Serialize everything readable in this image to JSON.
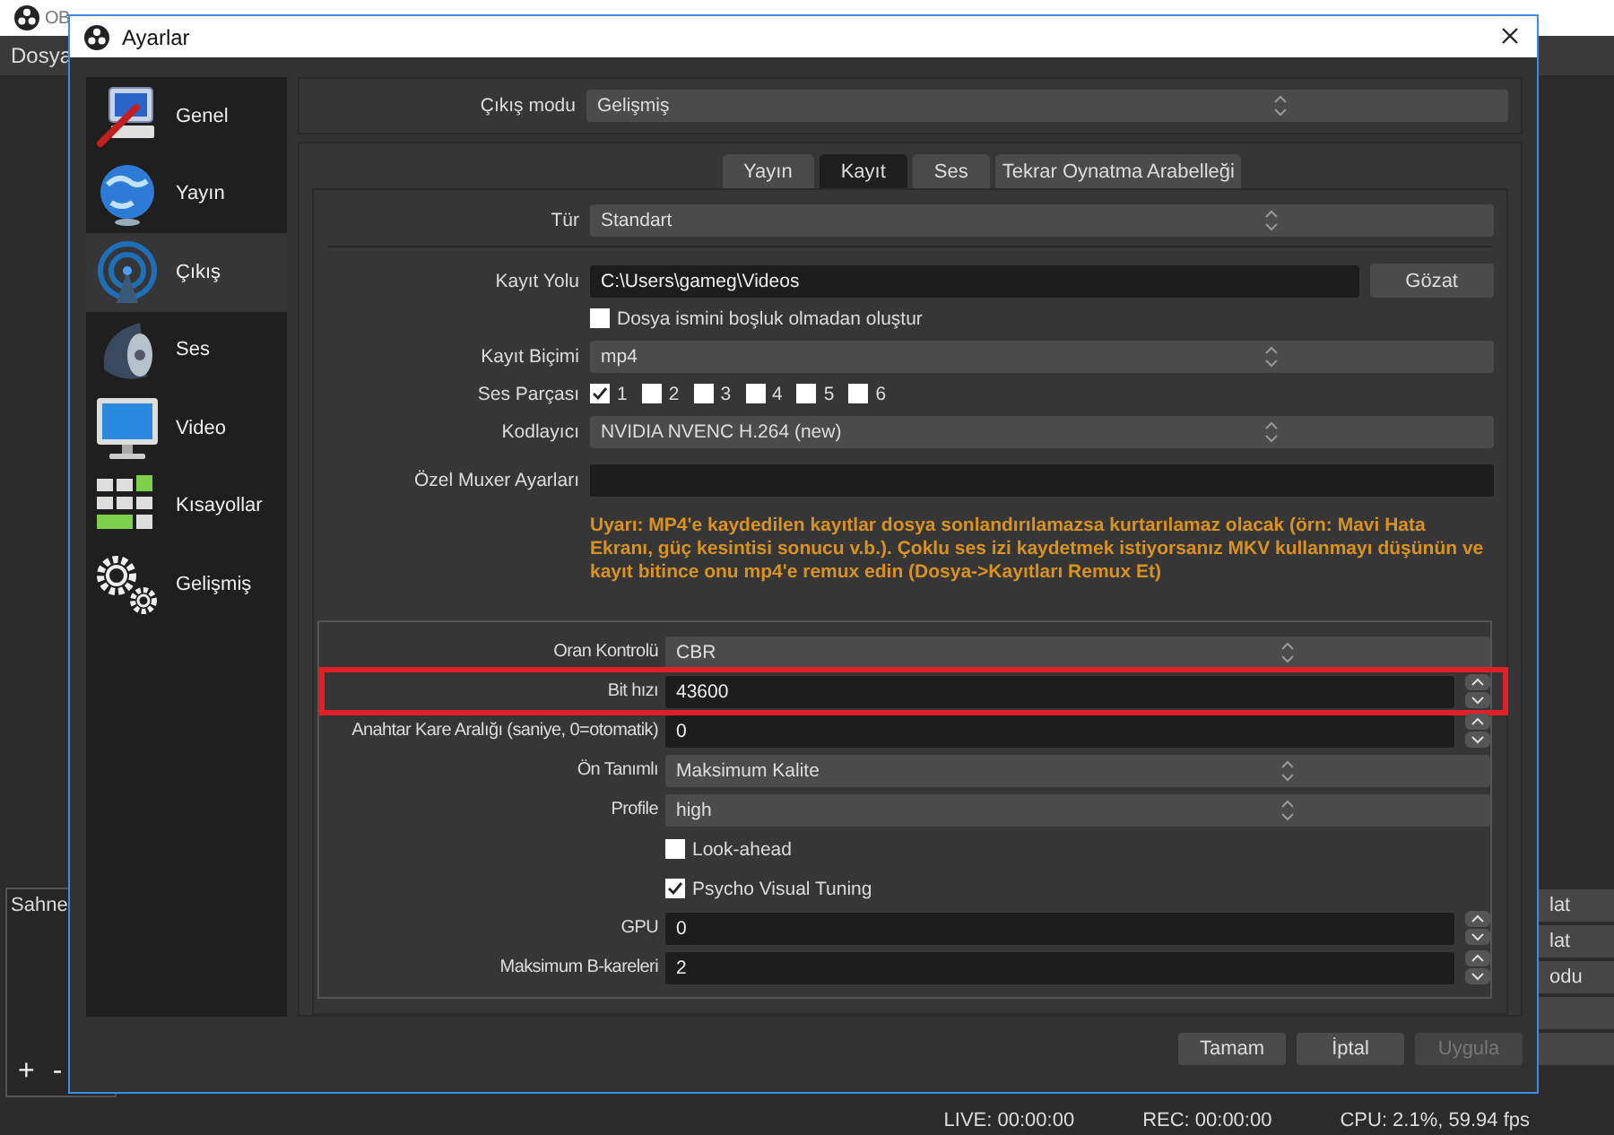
{
  "background_window": {
    "title": "OB",
    "menu": [
      "Dosya"
    ],
    "scenes_panel": {
      "title": "Sahne",
      "buttons": [
        "+",
        "-"
      ]
    },
    "side_buttons": [
      "lat",
      "lat",
      "odu"
    ],
    "status_bar": [
      "LIVE: 00:00:00",
      "REC: 00:00:00",
      "CPU: 2.1%, 59.94 fps"
    ]
  },
  "dialog": {
    "title": "Ayarlar",
    "sidebar": [
      {
        "label": "Genel",
        "selected": false
      },
      {
        "label": "Yayın",
        "selected": false
      },
      {
        "label": "Çıkış",
        "selected": true
      },
      {
        "label": "Ses",
        "selected": false
      },
      {
        "label": "Video",
        "selected": false
      },
      {
        "label": "Kısayollar",
        "selected": false
      },
      {
        "label": "Gelişmiş",
        "selected": false
      }
    ],
    "output_mode": {
      "label": "Çıkış modu",
      "value": "Gelişmiş"
    },
    "tabs": [
      {
        "label": "Yayın",
        "selected": false
      },
      {
        "label": "Kayıt",
        "selected": true
      },
      {
        "label": "Ses",
        "selected": false
      },
      {
        "label": "Tekrar Oynatma Arabelleği",
        "selected": false
      }
    ],
    "recording_type": {
      "label": "Tür",
      "value": "Standart"
    },
    "recording_rows": [
      {
        "kind": "path",
        "label": "Kayıt Yolu",
        "value": "C:\\Users\\gameg\\Videos",
        "button": "Gözat"
      },
      {
        "kind": "checkbox",
        "label": "Dosya ismini boşluk olmadan oluştur",
        "checked": false
      },
      {
        "kind": "select",
        "label": "Kayıt Biçimi",
        "value": "mp4"
      },
      {
        "kind": "tracks",
        "label": "Ses Parçası",
        "tracks": [
          {
            "label": "1",
            "checked": true
          },
          {
            "label": "2",
            "checked": false
          },
          {
            "label": "3",
            "checked": false
          },
          {
            "label": "4",
            "checked": false
          },
          {
            "label": "5",
            "checked": false
          },
          {
            "label": "6",
            "checked": false
          }
        ]
      },
      {
        "kind": "select",
        "label": "Kodlayıcı",
        "value": "NVIDIA NVENC H.264 (new)"
      },
      {
        "kind": "text",
        "label": "Özel Muxer Ayarları"
      },
      {
        "kind": "warning",
        "text": "Uyarı: MP4'e kaydedilen kayıtlar dosya sonlandırılamazsa kurtarılamaz olacak (örn: Mavi Hata Ekranı, güç kesintisi sonucu v.b.). Çoklu ses izi kaydetmek istiyorsanız MKV kullanmayı düşünün ve kayıt bitince onu mp4'e remux edin (Dosya->Kayıtları Remux Et)"
      }
    ],
    "encoder_rows": [
      {
        "kind": "select",
        "label": "Oran Kontrolü",
        "value": "CBR",
        "highlighted": false
      },
      {
        "kind": "spin",
        "label": "Bit hızı",
        "value": "43600",
        "highlighted": true
      },
      {
        "kind": "spin",
        "label": "Anahtar Kare Aralığı (saniye, 0=otomatik)",
        "value": "0",
        "highlighted": false
      },
      {
        "kind": "select",
        "label": "Ön Tanımlı",
        "value": "Maksimum Kalite",
        "highlighted": false
      },
      {
        "kind": "select",
        "label": "Profile",
        "value": "high",
        "highlighted": false
      },
      {
        "kind": "checkbox",
        "label": "Look-ahead",
        "checked": false,
        "highlighted": false
      },
      {
        "kind": "checkbox",
        "label": "Psycho Visual Tuning",
        "checked": true,
        "highlighted": false
      },
      {
        "kind": "spin",
        "label": "GPU",
        "value": "0",
        "highlighted": false
      },
      {
        "kind": "spin",
        "label": "Maksimum B-kareleri",
        "value": "2",
        "highlighted": false
      }
    ],
    "buttons": [
      {
        "label": "Tamam",
        "disabled": false
      },
      {
        "label": "İptal",
        "disabled": false
      },
      {
        "label": "Uygula",
        "disabled": true
      }
    ]
  }
}
